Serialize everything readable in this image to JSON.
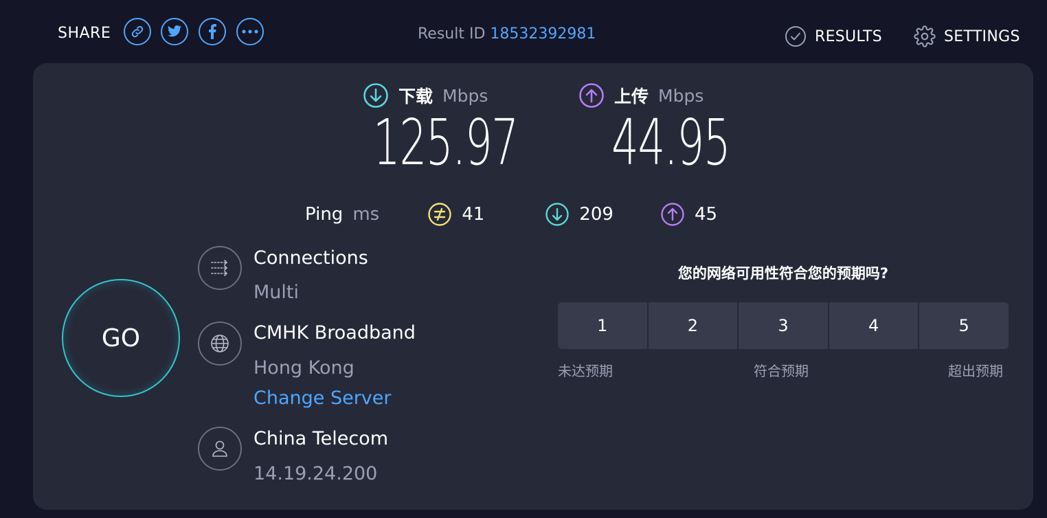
{
  "header": {
    "share_label": "SHARE",
    "share_icons": [
      "link-icon",
      "twitter-icon",
      "facebook-icon",
      "more-icon"
    ],
    "result_id_label": "Result ID",
    "result_id_value": "18532392981",
    "results_label": "RESULTS",
    "settings_label": "SETTINGS"
  },
  "speeds": {
    "download": {
      "label": "下载",
      "unit": "Mbps",
      "value": "125.97",
      "color": "#5ad8d8"
    },
    "upload": {
      "label": "上传",
      "unit": "Mbps",
      "value": "44.95",
      "color": "#b67cf6"
    }
  },
  "ping": {
    "label": "Ping",
    "unit": "ms",
    "idle": "41",
    "download": "209",
    "upload": "45",
    "idle_color": "#f0e27a"
  },
  "go_label": "GO",
  "connections": {
    "title": "Connections",
    "value": "Multi"
  },
  "server": {
    "name": "CMHK Broadband",
    "location": "Hong Kong",
    "change_label": "Change Server"
  },
  "isp": {
    "name": "China Telecom",
    "ip": "14.19.24.200"
  },
  "survey": {
    "question": "您的网络可用性符合您的预期吗?",
    "options": [
      "1",
      "2",
      "3",
      "4",
      "5"
    ],
    "low_label": "未达预期",
    "mid_label": "符合预期",
    "high_label": "超出预期"
  },
  "colors": {
    "accent": "#4ea6ff",
    "background": "#141526",
    "card": "#262938"
  }
}
